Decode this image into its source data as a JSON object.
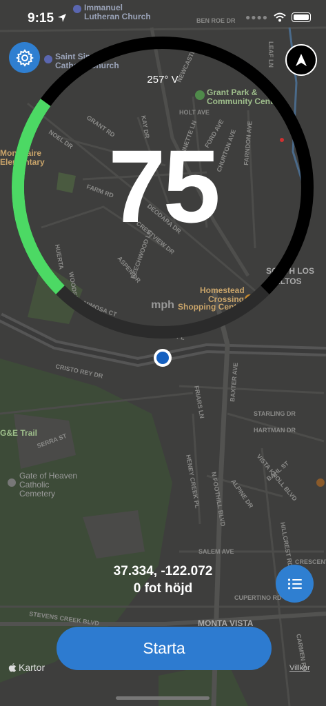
{
  "status_bar": {
    "time": "9:15"
  },
  "gauge": {
    "speed": "75",
    "unit": "mph",
    "heading": "257° V",
    "speed_fraction": 0.3,
    "colors": {
      "active": "#4cd964",
      "track": "#000000",
      "track_lower": "#2b2b2b"
    }
  },
  "location": {
    "coordinates": "37.334, -122.072",
    "altitude": "0 fot höjd"
  },
  "actions": {
    "start_label": "Starta"
  },
  "footer": {
    "maps_credit": "Kartor",
    "legal_label": "Villkor"
  },
  "map_labels": {
    "immanuel": "Immanuel",
    "lutheran": "Lutheran Church",
    "ben_roe": "BEN ROE DR",
    "leaf": "LEAF LN",
    "saint_simon": "Saint Simon",
    "catholic": "Catholic Church",
    "newcastle": "NEWCASTLE",
    "grant_park": "Grant Park &",
    "community_center": "Community Center",
    "grant_rd": "GRANT RD",
    "holt": "HOLT AVE",
    "noel": "NOEL DR",
    "kay": "KAY DR",
    "jeannette": "JEANNETTE LN",
    "ford": "FORD AVE",
    "churton": "CHURTON AVE",
    "farndon": "FARNDON AVE",
    "montclaire": "Montclaire",
    "elementary": "Elementary",
    "farm": "FARM RD",
    "deodara": "DEODARA DR",
    "crestview": "CRESTVIEW DR",
    "aspen": "ASPEN DR",
    "beechwood": "BEECHWOOD LN",
    "huerta": "HUERTA",
    "woodsen": "WOODSEN",
    "south_los": "SOUTH LOS",
    "altos": "ALTOS",
    "homestead": "Homestead",
    "crossing": "Crossing",
    "shopping": "Shopping Center",
    "mimosa": "MIMOSA CT",
    "cedar": "CEDAR PL",
    "cristo_rey": "CRISTO REY DR",
    "baxter": "BAXTER AVE",
    "starling": "STARLING DR",
    "hartman": "HARTMAN DR",
    "serra": "SERRA ST",
    "ge_trail": "G&E Trail",
    "friars": "FRIARS LN",
    "vista_knoll": "VISTA KNOLL BLVD",
    "bahl": "BAHL ST",
    "gate_heaven": "Gate of Heaven",
    "gate_catholic": "Catholic",
    "cemetery": "Cemetery",
    "heney": "HENEY CREEK PL",
    "foothill": "N FOOTHILL BLVD",
    "alpine": "ALPINE DR",
    "hillcrest": "HILLCREST RD",
    "salem": "SALEM AVE",
    "crescent": "CRESCENT RD",
    "cupertino": "CUPERTINO RD",
    "stevens": "STEVENS CREEK BLVD",
    "monta_vista": "MONTA VISTA",
    "carmen": "CARMEN RD"
  }
}
